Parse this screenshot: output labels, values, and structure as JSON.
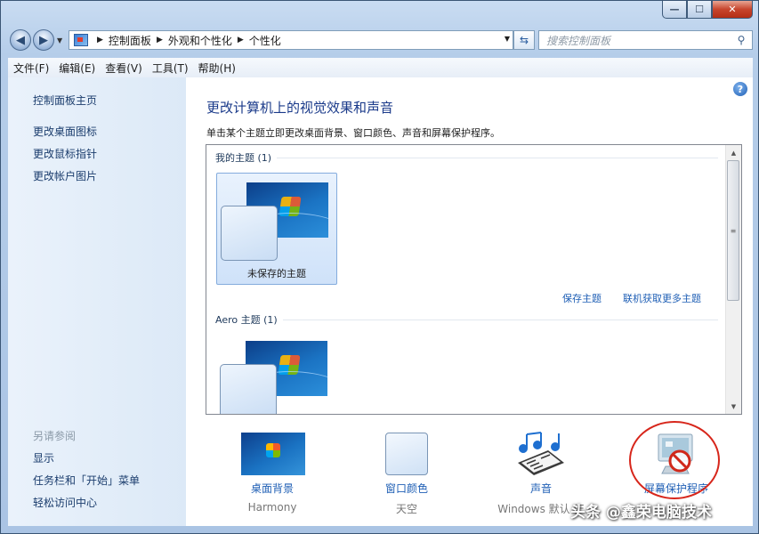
{
  "window": {
    "min_glyph": "—",
    "max_glyph": "☐",
    "close_glyph": "✕"
  },
  "address": {
    "crumbs": [
      "控制面板",
      "外观和个性化",
      "个性化"
    ],
    "separator": "▶"
  },
  "search": {
    "placeholder": "搜索控制面板"
  },
  "menu": [
    "文件(F)",
    "编辑(E)",
    "查看(V)",
    "工具(T)",
    "帮助(H)"
  ],
  "sidebar": {
    "links": [
      "控制面板主页",
      "更改桌面图标",
      "更改鼠标指针",
      "更改帐户图片"
    ],
    "see_also_heading": "另请参阅",
    "see_also": [
      "显示",
      "任务栏和「开始」菜单",
      "轻松访问中心"
    ]
  },
  "main": {
    "help": "?",
    "title": "更改计算机上的视觉效果和声音",
    "description": "单击某个主题立即更改桌面背景、窗口颜色、声音和屏幕保护程序。",
    "my_themes_heading": "我的主题 (1)",
    "unsaved_theme": "未保存的主题",
    "save_theme": "保存主题",
    "get_more_themes": "联机获取更多主题",
    "aero_heading": "Aero 主题 (1)"
  },
  "bottom": [
    {
      "label": "桌面背景",
      "sub": "Harmony",
      "icon": "desktop-background-icon"
    },
    {
      "label": "窗口颜色",
      "sub": "天空",
      "icon": "window-color-icon"
    },
    {
      "label": "声音",
      "sub": "Windows 默认 (E",
      "icon": "sound-icon"
    },
    {
      "label": "屏幕保护程序",
      "sub": "",
      "icon": "screen-saver-icon"
    }
  ],
  "watermark": "头条 @鑫荣电脑技术",
  "colors": {
    "link": "#1f5fb5",
    "title": "#1a3a8a",
    "highlight_circle": "#d7261b"
  }
}
